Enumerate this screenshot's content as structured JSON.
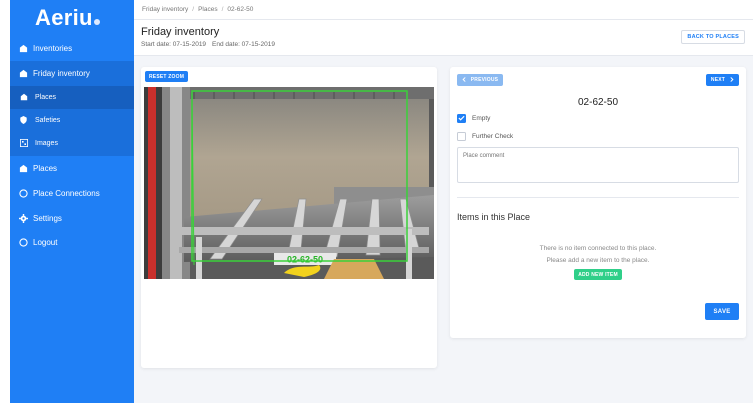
{
  "app": {
    "logo": "Aeriu"
  },
  "sidebar": {
    "items": [
      {
        "label": "Inventories",
        "icon": "stack-icon"
      },
      {
        "label": "Friday inventory",
        "icon": "stack-icon"
      },
      {
        "label": "Places",
        "icon": "stack-icon"
      },
      {
        "label": "Connections",
        "icon": "circle-icon"
      },
      {
        "label": "Settings",
        "icon": "gear-icon"
      },
      {
        "label": "Logout",
        "icon": "circle-icon"
      }
    ],
    "subitems": [
      {
        "label": "Places",
        "icon": "stack-icon"
      },
      {
        "label": "Safeties",
        "icon": "shield-icon"
      },
      {
        "label": "Images",
        "icon": "image-icon"
      }
    ],
    "place_connections": "Place Connections"
  },
  "breadcrumb": [
    "Friday inventory",
    "Places",
    "02-62-50"
  ],
  "header": {
    "title": "Friday inventory",
    "start_date": "Start date: 07-15-2019",
    "end_date": "End date: 07-15-2019",
    "back_button": "BACK TO PLACES"
  },
  "image_panel": {
    "reset_zoom": "RESET ZOOM",
    "label_on_image": "02-62-50"
  },
  "place_panel": {
    "prev": "PREVIOUS",
    "next": "NEXT",
    "code": "02-62-50",
    "empty_label": "Empty",
    "empty_checked": true,
    "further_check_label": "Further Check",
    "further_check_checked": false,
    "comment_placeholder": "Place comment",
    "items_title": "Items in this Place",
    "no_items_line1": "There is no item connected to this place.",
    "no_items_line2": "Please add a new item to the place.",
    "add_item": "ADD NEW ITEM",
    "save": "SAVE"
  },
  "colors": {
    "primary": "#1f7ff5",
    "success": "#2fcf89",
    "detection_box": "#3ad13a"
  }
}
